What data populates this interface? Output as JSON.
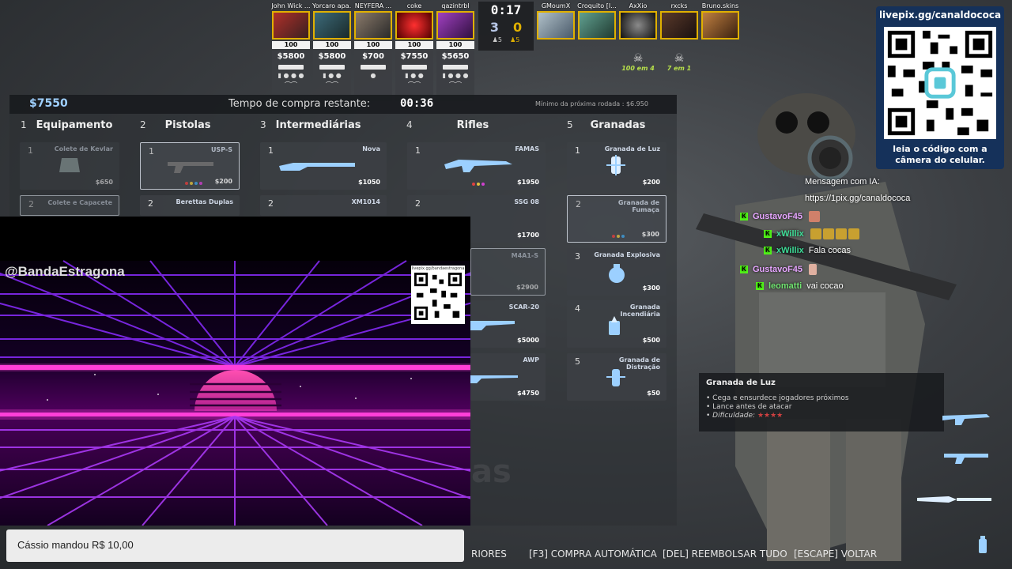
{
  "scoreboard": {
    "ct_players": [
      {
        "name": "John Wick ...",
        "hp": "100",
        "money": "$5800"
      },
      {
        "name": "Yorcaro apa...",
        "hp": "100",
        "money": "$5800"
      },
      {
        "name": "NEYFERA ...",
        "hp": "100",
        "money": "$700"
      },
      {
        "name": "coke",
        "hp": "100",
        "money": "$7550"
      },
      {
        "name": "qazintrbl",
        "hp": "100",
        "money": "$5650"
      }
    ],
    "t_players": [
      {
        "name": "GMoumX"
      },
      {
        "name": "Croquito [I..."
      },
      {
        "name": "AxXio"
      },
      {
        "name": "rxcks"
      },
      {
        "name": "Bruno.skins"
      }
    ],
    "timer": "0:17",
    "score_ct": "3",
    "score_t": "0",
    "alive_ct": "♟5",
    "alive_t": "♟5",
    "kill_badges": [
      "100 em 4",
      "7 em 1"
    ]
  },
  "buy_menu": {
    "money": "$7550",
    "time_left_label": "Tempo de compra restante:",
    "time_left_value": "00:36",
    "min_next_round": "Mínimo da próxima rodada : $6.950",
    "categories": [
      {
        "num": "1",
        "label": "Equipamento"
      },
      {
        "num": "2",
        "label": "Pistolas"
      },
      {
        "num": "3",
        "label": "Intermediárias"
      },
      {
        "num": "4",
        "label": "Rifles"
      },
      {
        "num": "5",
        "label": "Granadas"
      }
    ],
    "items": {
      "equip_1": {
        "num": "1",
        "name": "Colete de Kevlar",
        "price": "$650"
      },
      "equip_2": {
        "num": "2",
        "name": "Colete e Capacete"
      },
      "pistol_1": {
        "num": "1",
        "name": "USP-S",
        "price": "$200"
      },
      "pistol_2": {
        "num": "2",
        "name": "Berettas Duplas"
      },
      "mid_1": {
        "num": "1",
        "name": "Nova",
        "price": "$1050"
      },
      "mid_2": {
        "num": "2",
        "name": "XM1014"
      },
      "rifle_1": {
        "num": "1",
        "name": "FAMAS",
        "price": "$1950"
      },
      "rifle_2": {
        "num": "2",
        "name": "SSG 08",
        "price": "$1700"
      },
      "rifle_3": {
        "name": "M4A1-S",
        "price": "$2900"
      },
      "rifle_4": {
        "name": "SCAR-20",
        "price": "$5000"
      },
      "rifle_5": {
        "name": "AWP",
        "price": "$4750"
      },
      "nade_1": {
        "num": "1",
        "name": "Granada de Luz",
        "price": "$200"
      },
      "nade_2": {
        "num": "2",
        "name": "Granada de Fumaça",
        "price": "$300"
      },
      "nade_3": {
        "num": "3",
        "name": "Granada Explosiva",
        "price": "$300"
      },
      "nade_4": {
        "num": "4",
        "name": "Granada Incendiária",
        "price": "$500"
      },
      "nade_5": {
        "num": "5",
        "name": "Granada de Distração",
        "price": "$50"
      }
    },
    "bottom_actions": {
      "prev": "RIORES",
      "auto": "[F3] COMPRA AUTOMÁTICA",
      "refund": "[DEL] REEMBOLSAR TUDO",
      "back": "[ESCAPE] VOLTAR"
    },
    "watermark": "as"
  },
  "tooltip": {
    "title": "Granada de Luz",
    "line1": "• Cega e ensurdece jogadores próximos",
    "line2": "• Lance antes de atacar",
    "line3": "• Dificuldade:",
    "stars": "★★★★"
  },
  "qr": {
    "url": "livepix.gg/canaldococa",
    "caption": "leia o código com a câmera do celular."
  },
  "chat": {
    "header1": "Mensagem com IA:",
    "header2": "https://1pix.gg/canaldococa",
    "messages": [
      {
        "user": "GustavoF45",
        "text": "",
        "color": "#e6a5ff"
      },
      {
        "user": "xWillix",
        "text": "",
        "color": "#3ddc97"
      },
      {
        "user": "xWillix",
        "text": "Fala cocas",
        "color": "#3ddc97"
      },
      {
        "user": "GustavoF45",
        "text": "",
        "color": "#e6a5ff"
      },
      {
        "user": "leomatti",
        "text": "vai cocao",
        "color": "#6fe36f"
      }
    ]
  },
  "overlay": {
    "handle": "@BandaEstragona",
    "small_qr_url": "livepix.gg/bandaestragona",
    "donation": "Cássio mandou R$ 10,00"
  },
  "colors": {
    "accent_gold": "#e0b000",
    "money_blue": "#9fd0ff",
    "kick_green": "#53fc18",
    "qr_panel": "#15315a",
    "synth_pink": "#ff3fd8"
  }
}
